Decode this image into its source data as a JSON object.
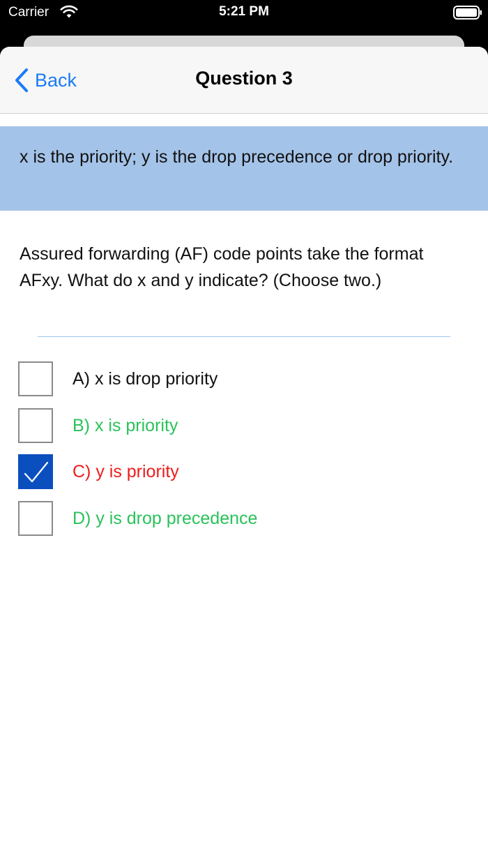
{
  "status_bar": {
    "carrier": "Carrier",
    "time": "5:21 PM",
    "wifi_icon": "wifi-icon",
    "battery_icon": "battery-icon"
  },
  "nav": {
    "back_label": "Back",
    "back_icon": "chevron-left-icon",
    "title": "Question 3"
  },
  "answer": {
    "text": "x is the priority; y is the drop precedence or drop priority."
  },
  "question": {
    "text": "Assured forwarding (AF) code points take the format AFxy. What do x and y indicate? (Choose two.)"
  },
  "options": [
    {
      "label": "A) x is drop priority",
      "checked": false,
      "state": "neutral"
    },
    {
      "label": "B) x is priority",
      "checked": false,
      "state": "correct"
    },
    {
      "label": "C) y is priority",
      "checked": true,
      "state": "incorrect"
    },
    {
      "label": "D) y is drop precedence",
      "checked": false,
      "state": "correct"
    }
  ],
  "colors": {
    "accent": "#1a7cf5",
    "banner": "#a4c3e8",
    "checkbox_checked": "#0b4fbf",
    "neutral_text": "#111111",
    "correct_text": "#2ac25a",
    "incorrect_text": "#ee1c1c",
    "divider": "#9cc8ef"
  }
}
